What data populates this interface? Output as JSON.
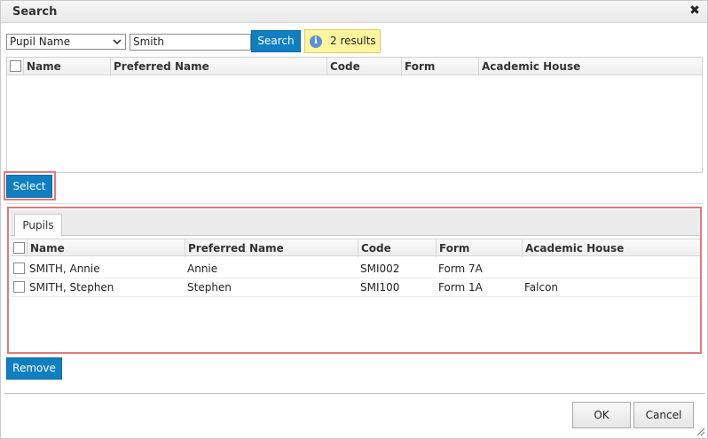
{
  "dialog": {
    "title": "Search",
    "close_icon": "close-icon"
  },
  "search": {
    "field_selected": "Pupil Name",
    "query_value": "Smith",
    "button_label": "Search",
    "results_text": "2 results",
    "info_icon": "info-icon"
  },
  "results_grid": {
    "columns": [
      "Name",
      "Preferred Name",
      "Code",
      "Form",
      "Academic House"
    ],
    "rows": []
  },
  "select_button": "Select",
  "pupils_panel": {
    "tab_label": "Pupils",
    "columns": [
      "Name",
      "Preferred Name",
      "Code",
      "Form",
      "Academic House"
    ],
    "rows": [
      {
        "name": "SMITH, Annie",
        "preferred": "Annie",
        "code": "SMI002",
        "form": "Form 7A",
        "house": ""
      },
      {
        "name": "SMITH, Stephen",
        "preferred": "Stephen",
        "code": "SMI100",
        "form": "Form 1A",
        "house": "Falcon"
      }
    ]
  },
  "remove_button": "Remove",
  "footer": {
    "ok": "OK",
    "cancel": "Cancel"
  },
  "colors": {
    "accent": "#0f7fc2",
    "highlight": "#e07a7a",
    "results_bg": "#fff59d"
  }
}
